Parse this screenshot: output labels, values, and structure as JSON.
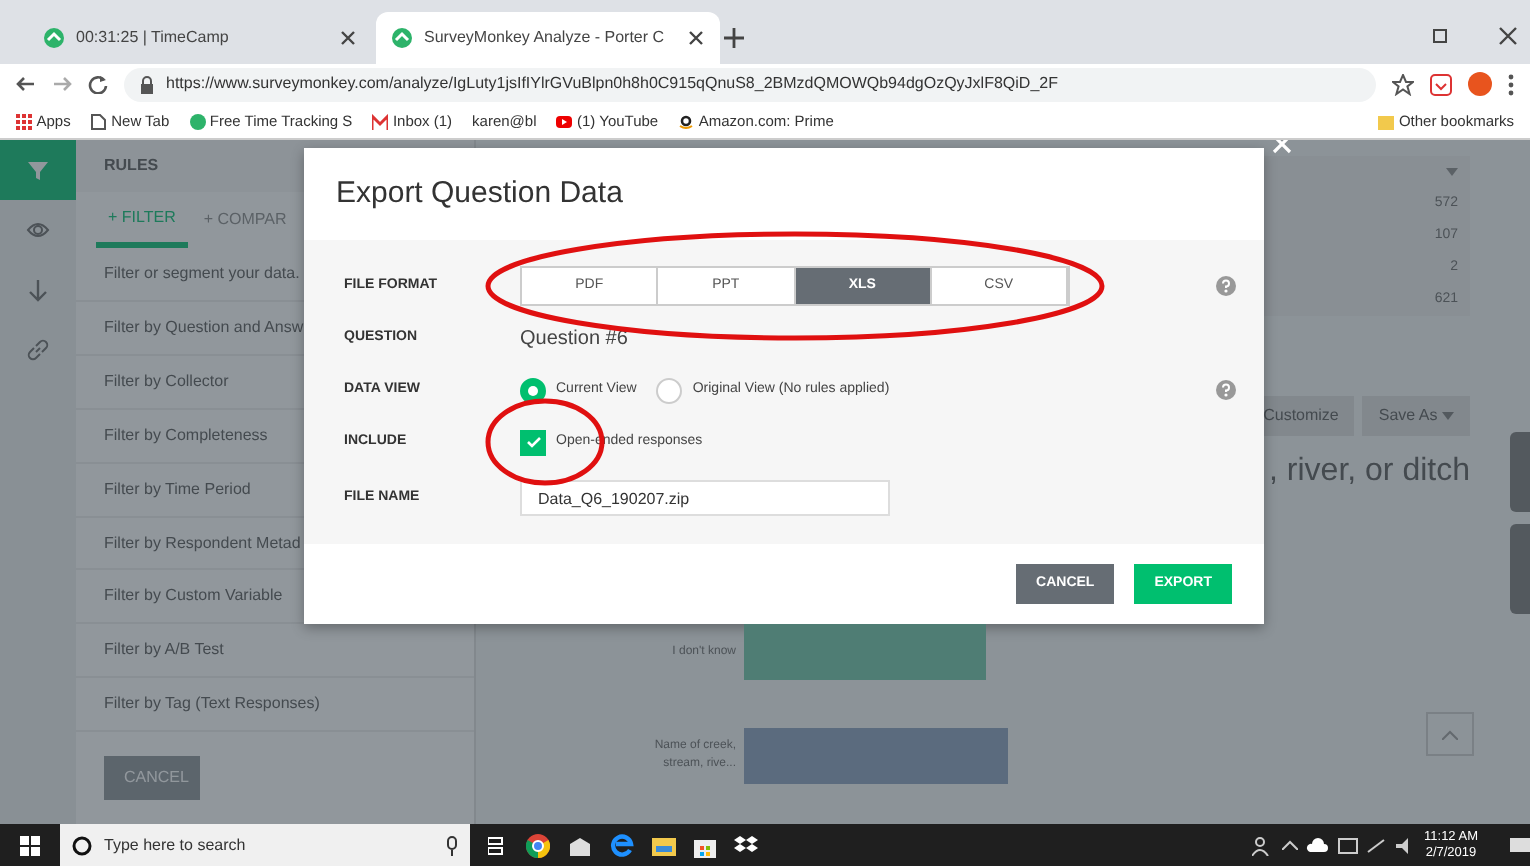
{
  "browser": {
    "tabs": [
      {
        "title": "00:31:25 | TimeCamp",
        "selected": false
      },
      {
        "title": "SurveyMonkey Analyze - Porter C",
        "selected": true
      }
    ],
    "url": "https://www.surveymonkey.com/analyze/IgLuty1jsIfIYlrGVuBlpn0h8h0C915qQnuS8_2BMzdQMOWQb94dgOzQyJxlF8QiD_2F",
    "bookmarks": [
      {
        "label": "Apps"
      },
      {
        "label": "New Tab"
      },
      {
        "label": "Free Time Tracking S"
      },
      {
        "label": "Inbox (1)"
      },
      {
        "label": "karen@bl"
      },
      {
        "label": "(1) YouTube"
      },
      {
        "label": "Amazon.com: Prime"
      }
    ],
    "other_bookmarks": "Other bookmarks"
  },
  "sidebar": {
    "title": "RULES",
    "tabs": [
      {
        "label": "+ FILTER",
        "selected": true
      },
      {
        "label": "+ COMPAR",
        "selected": false
      }
    ],
    "hint": "Filter or segment your data.",
    "filters": [
      {
        "label": "Filter by Question and Answ"
      },
      {
        "label": "Filter by Collector"
      },
      {
        "label": "Filter by Completeness"
      },
      {
        "label": "Filter by Time Period"
      },
      {
        "label": "Filter by Respondent Metad"
      },
      {
        "label": "Filter by Custom Variable"
      },
      {
        "label": "Filter by A/B Test"
      },
      {
        "label": "Filter by Tag (Text Responses)"
      }
    ],
    "cancel": "CANCEL"
  },
  "summary": {
    "values": [
      "572",
      "107",
      "2",
      "621"
    ]
  },
  "toolbar": {
    "buttons": [
      "Customize",
      "Save As"
    ]
  },
  "question_title": ", river, or ditch",
  "bars": [
    {
      "label": "I don't know",
      "level": 0.55,
      "color": "#4f7d74"
    },
    {
      "label": "Name of creek, stream, rive...",
      "level": 0.6,
      "color": "#5b6b7e"
    }
  ],
  "modal": {
    "title": "Export Question Data",
    "file_format": {
      "label": "FILE FORMAT",
      "circled": true,
      "options": [
        {
          "label": "PDF",
          "selected": false
        },
        {
          "label": "PPT",
          "selected": false
        },
        {
          "label": "XLS",
          "selected": true
        },
        {
          "label": "CSV",
          "selected": false
        }
      ]
    },
    "question": {
      "label": "QUESTION",
      "value": "Question #6"
    },
    "data_view": {
      "label": "DATA VIEW",
      "options": [
        {
          "label": "Current View",
          "selected": true
        },
        {
          "label": "Original View (No rules applied)",
          "selected": false
        }
      ]
    },
    "include": {
      "label": "INCLUDE",
      "circled": true,
      "options": [
        {
          "label": "Open-ended responses",
          "checked": true
        }
      ]
    },
    "file_name": {
      "label": "FILE NAME",
      "value": "Data_Q6_190207.zip"
    },
    "buttons": [
      {
        "label": "CANCEL",
        "kind": "secondary"
      },
      {
        "label": "EXPORT",
        "kind": "primary"
      }
    ]
  },
  "taskbar": {
    "search_placeholder": "Type here to search",
    "time": "11:12 AM",
    "date": "2/7/2019"
  }
}
